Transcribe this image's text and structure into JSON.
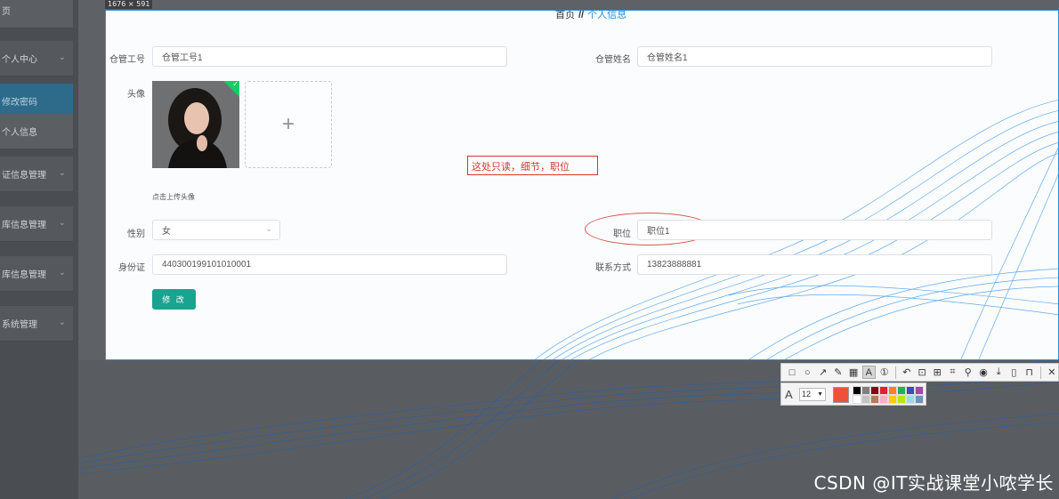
{
  "dimension_label": "1676 × 591",
  "sidebar": {
    "items": [
      {
        "label": "页",
        "chevron": false
      },
      {
        "label": "个人中心",
        "chevron": true
      },
      {
        "label": "修改密码",
        "chevron": false,
        "active": true
      },
      {
        "label": "个人信息",
        "chevron": false
      },
      {
        "label": "证信息管理",
        "chevron": true
      },
      {
        "label": "库信息管理",
        "chevron": true
      },
      {
        "label": "库信息管理",
        "chevron": true
      },
      {
        "label": "系统管理",
        "chevron": true
      }
    ]
  },
  "breadcrumb": {
    "home": "首页",
    "separator": "//",
    "current": "个人信息"
  },
  "form": {
    "staff_id": {
      "label": "仓管工号",
      "value": "仓管工号1"
    },
    "staff_name": {
      "label": "仓管姓名",
      "value": "仓管姓名1"
    },
    "avatar": {
      "label": "头像",
      "upload_hint": "点击上传头像",
      "plus": "+"
    },
    "gender": {
      "label": "性别",
      "value": "女"
    },
    "position": {
      "label": "职位",
      "value": "职位1"
    },
    "id_card": {
      "label": "身份证",
      "value": "440300199101010001"
    },
    "phone": {
      "label": "联系方式",
      "value": "13823888881"
    },
    "submit_label": "修 改"
  },
  "annotation": {
    "text": "这处只读，细节，职位"
  },
  "toolbar": {
    "icons": [
      "rect-icon",
      "ellipse-icon",
      "arrow-icon",
      "pencil-icon",
      "mosaic-icon",
      "text-icon",
      "number-icon",
      "undo-icon",
      "pin-icon",
      "ocr-icon",
      "scan-icon",
      "sticker-icon",
      "record-icon",
      "download-icon",
      "save-icon",
      "bookmark-icon",
      "close-icon"
    ],
    "font_size": "12",
    "current_color": "#f0503a",
    "palette": [
      "#000000",
      "#7f7f7f",
      "#880015",
      "#ed1c24",
      "#ff7f27",
      "#22b14c",
      "#3f48cc",
      "#a349a4",
      "#ffffff",
      "#c3c3c3",
      "#b97a57",
      "#ffaec9",
      "#ffc90e",
      "#b5e61d",
      "#99d9ea",
      "#7092be"
    ]
  },
  "watermark": "CSDN @IT实战课堂小哝学长"
}
